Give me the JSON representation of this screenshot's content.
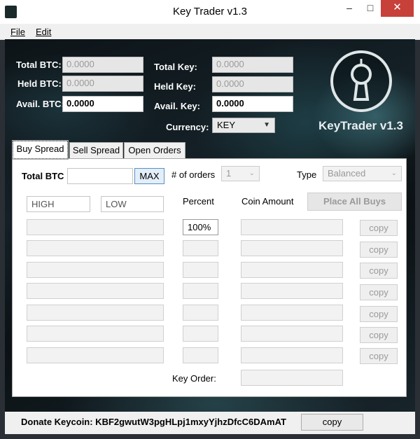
{
  "window": {
    "title": "Key Trader v1.3",
    "minimize": "–",
    "maximize": "□",
    "close": "✕"
  },
  "menu": {
    "file": "File",
    "edit": "Edit"
  },
  "stats": {
    "total_btc_label": "Total BTC:",
    "total_btc": "0.0000",
    "held_btc_label": "Held BTC:",
    "held_btc": "0.0000",
    "avail_btc_label": "Avail. BTC:",
    "avail_btc": "0.0000",
    "total_key_label": "Total Key:",
    "total_key": "0.0000",
    "held_key_label": "Held Key:",
    "held_key": "0.0000",
    "avail_key_label": "Avail. Key:",
    "avail_key": "0.0000",
    "currency_label": "Currency:",
    "currency": "KEY"
  },
  "logo": {
    "text": "KeyTrader v1.3"
  },
  "tabs": [
    {
      "label": "Buy Spread"
    },
    {
      "label": "Sell Spread"
    },
    {
      "label": "Open Orders"
    }
  ],
  "buy": {
    "total_btc_label": "Total BTC",
    "total_btc_value": "",
    "max_label": "MAX",
    "orders_label": "# of orders",
    "orders_value": "1",
    "type_label": "Type",
    "type_value": "Balanced",
    "high_placeholder": "HIGH",
    "low_placeholder": "LOW",
    "percent_label": "Percent",
    "coin_amount_label": "Coin Amount",
    "place_all_label": "Place All Buys",
    "first_percent": "100%",
    "copy_label": "copy",
    "key_order_label": "Key Order:"
  },
  "donate": {
    "label": "Donate Keycoin: KBF2gwutW3pgHLpj1mxyYjhzDfcC6DAmAT",
    "copy_label": "copy"
  }
}
